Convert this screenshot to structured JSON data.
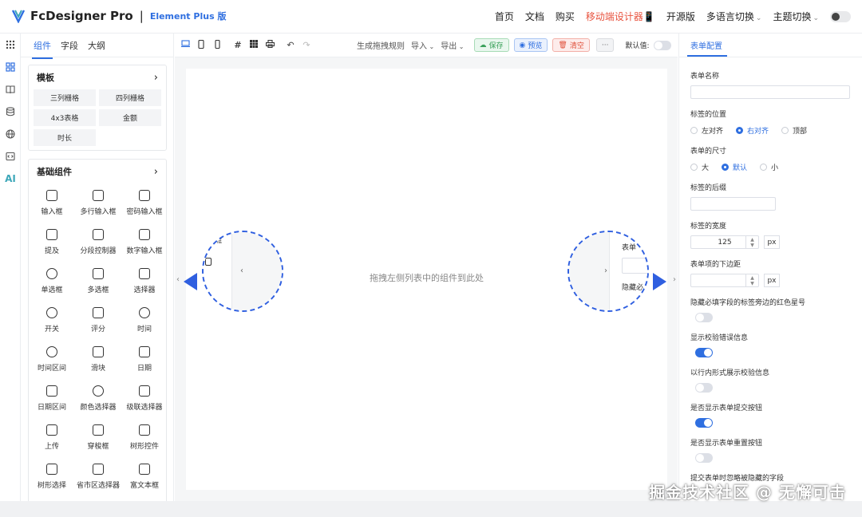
{
  "app": {
    "name": "FcDesigner Pro",
    "separator": "|",
    "subtitle": "Element Plus 版"
  },
  "nav": {
    "items": [
      {
        "label": "首页",
        "red": false,
        "caret": false
      },
      {
        "label": "文档",
        "red": false,
        "caret": false
      },
      {
        "label": "购买",
        "red": false,
        "caret": false
      },
      {
        "label": "移动端设计器📱",
        "red": true,
        "caret": false
      },
      {
        "label": "开源版",
        "red": false,
        "caret": false
      },
      {
        "label": "多语言切换",
        "red": false,
        "caret": true
      },
      {
        "label": "主题切换",
        "red": false,
        "caret": true
      }
    ]
  },
  "left": {
    "tabs": [
      "组件",
      "字段",
      "大纲"
    ],
    "template": {
      "title": "模板",
      "items": [
        "三列栅格",
        "四列栅格",
        "4x3表格",
        "金额",
        "时长"
      ]
    },
    "basic": {
      "title": "基础组件",
      "items": [
        {
          "label": "输入框",
          "icon": "text-input-icon"
        },
        {
          "label": "多行输入框",
          "icon": "textarea-icon"
        },
        {
          "label": "密码输入框",
          "icon": "password-icon"
        },
        {
          "label": "提及",
          "icon": "mention-icon"
        },
        {
          "label": "分段控制器",
          "icon": "segmented-icon"
        },
        {
          "label": "数字输入框",
          "icon": "number-input-icon"
        },
        {
          "label": "单选框",
          "icon": "radio-icon"
        },
        {
          "label": "多选框",
          "icon": "checkbox-icon"
        },
        {
          "label": "选择器",
          "icon": "select-icon"
        },
        {
          "label": "开关",
          "icon": "switch-icon"
        },
        {
          "label": "评分",
          "icon": "star-icon"
        },
        {
          "label": "时间",
          "icon": "clock-icon"
        },
        {
          "label": "时间区间",
          "icon": "time-range-icon"
        },
        {
          "label": "滑块",
          "icon": "slider-icon"
        },
        {
          "label": "日期",
          "icon": "calendar-icon"
        },
        {
          "label": "日期区间",
          "icon": "date-range-icon"
        },
        {
          "label": "颜色选择器",
          "icon": "palette-icon"
        },
        {
          "label": "级联选择器",
          "icon": "cascader-icon"
        },
        {
          "label": "上传",
          "icon": "upload-icon"
        },
        {
          "label": "穿梭框",
          "icon": "transfer-icon"
        },
        {
          "label": "树形控件",
          "icon": "tree-icon"
        },
        {
          "label": "树形选择",
          "icon": "tree-select-icon"
        },
        {
          "label": "省市区选择器",
          "icon": "region-icon"
        },
        {
          "label": "富文本框",
          "icon": "rich-text-icon"
        }
      ]
    }
  },
  "toolbar": {
    "rules": "生成拖拽规则",
    "import": "导入",
    "export": "导出",
    "save": "保存",
    "preview": "预览",
    "clear": "清空",
    "more": "···",
    "default_value": "默认值:"
  },
  "canvas": {
    "placeholder": "拖拽左侧列表中的组件到此处"
  },
  "magnifier": {
    "left_label": "框",
    "right_label_top": "表单",
    "right_label_bottom": "隐藏必"
  },
  "right": {
    "tab": "表单配置",
    "form_name_label": "表单名称",
    "label_position": {
      "label": "标签的位置",
      "options": [
        "左对齐",
        "右对齐",
        "顶部"
      ],
      "selected": 1
    },
    "form_size": {
      "label": "表单的尺寸",
      "options": [
        "大",
        "默认",
        "小"
      ],
      "selected": 1
    },
    "label_suffix": "标签的后缀",
    "label_width": {
      "label": "标签的宽度",
      "value": "125",
      "unit": "px"
    },
    "item_margin": {
      "label": "表单项的下边距",
      "value": "",
      "unit": "px"
    },
    "switches": [
      {
        "label": "隐藏必填字段的标签旁边的红色星号",
        "on": false
      },
      {
        "label": "显示校验错误信息",
        "on": true
      },
      {
        "label": "以行内形式展示校验信息",
        "on": false
      },
      {
        "label": "是否显示表单提交按钮",
        "on": true
      },
      {
        "label": "是否显示表单重置按钮",
        "on": false
      }
    ],
    "last_label": "提交表单时忽略被隐藏的字段"
  },
  "watermark": "掘金技术社区 @ 无懈可击",
  "colors": {
    "accent": "#2f6fe0",
    "red": "#e8533f"
  }
}
